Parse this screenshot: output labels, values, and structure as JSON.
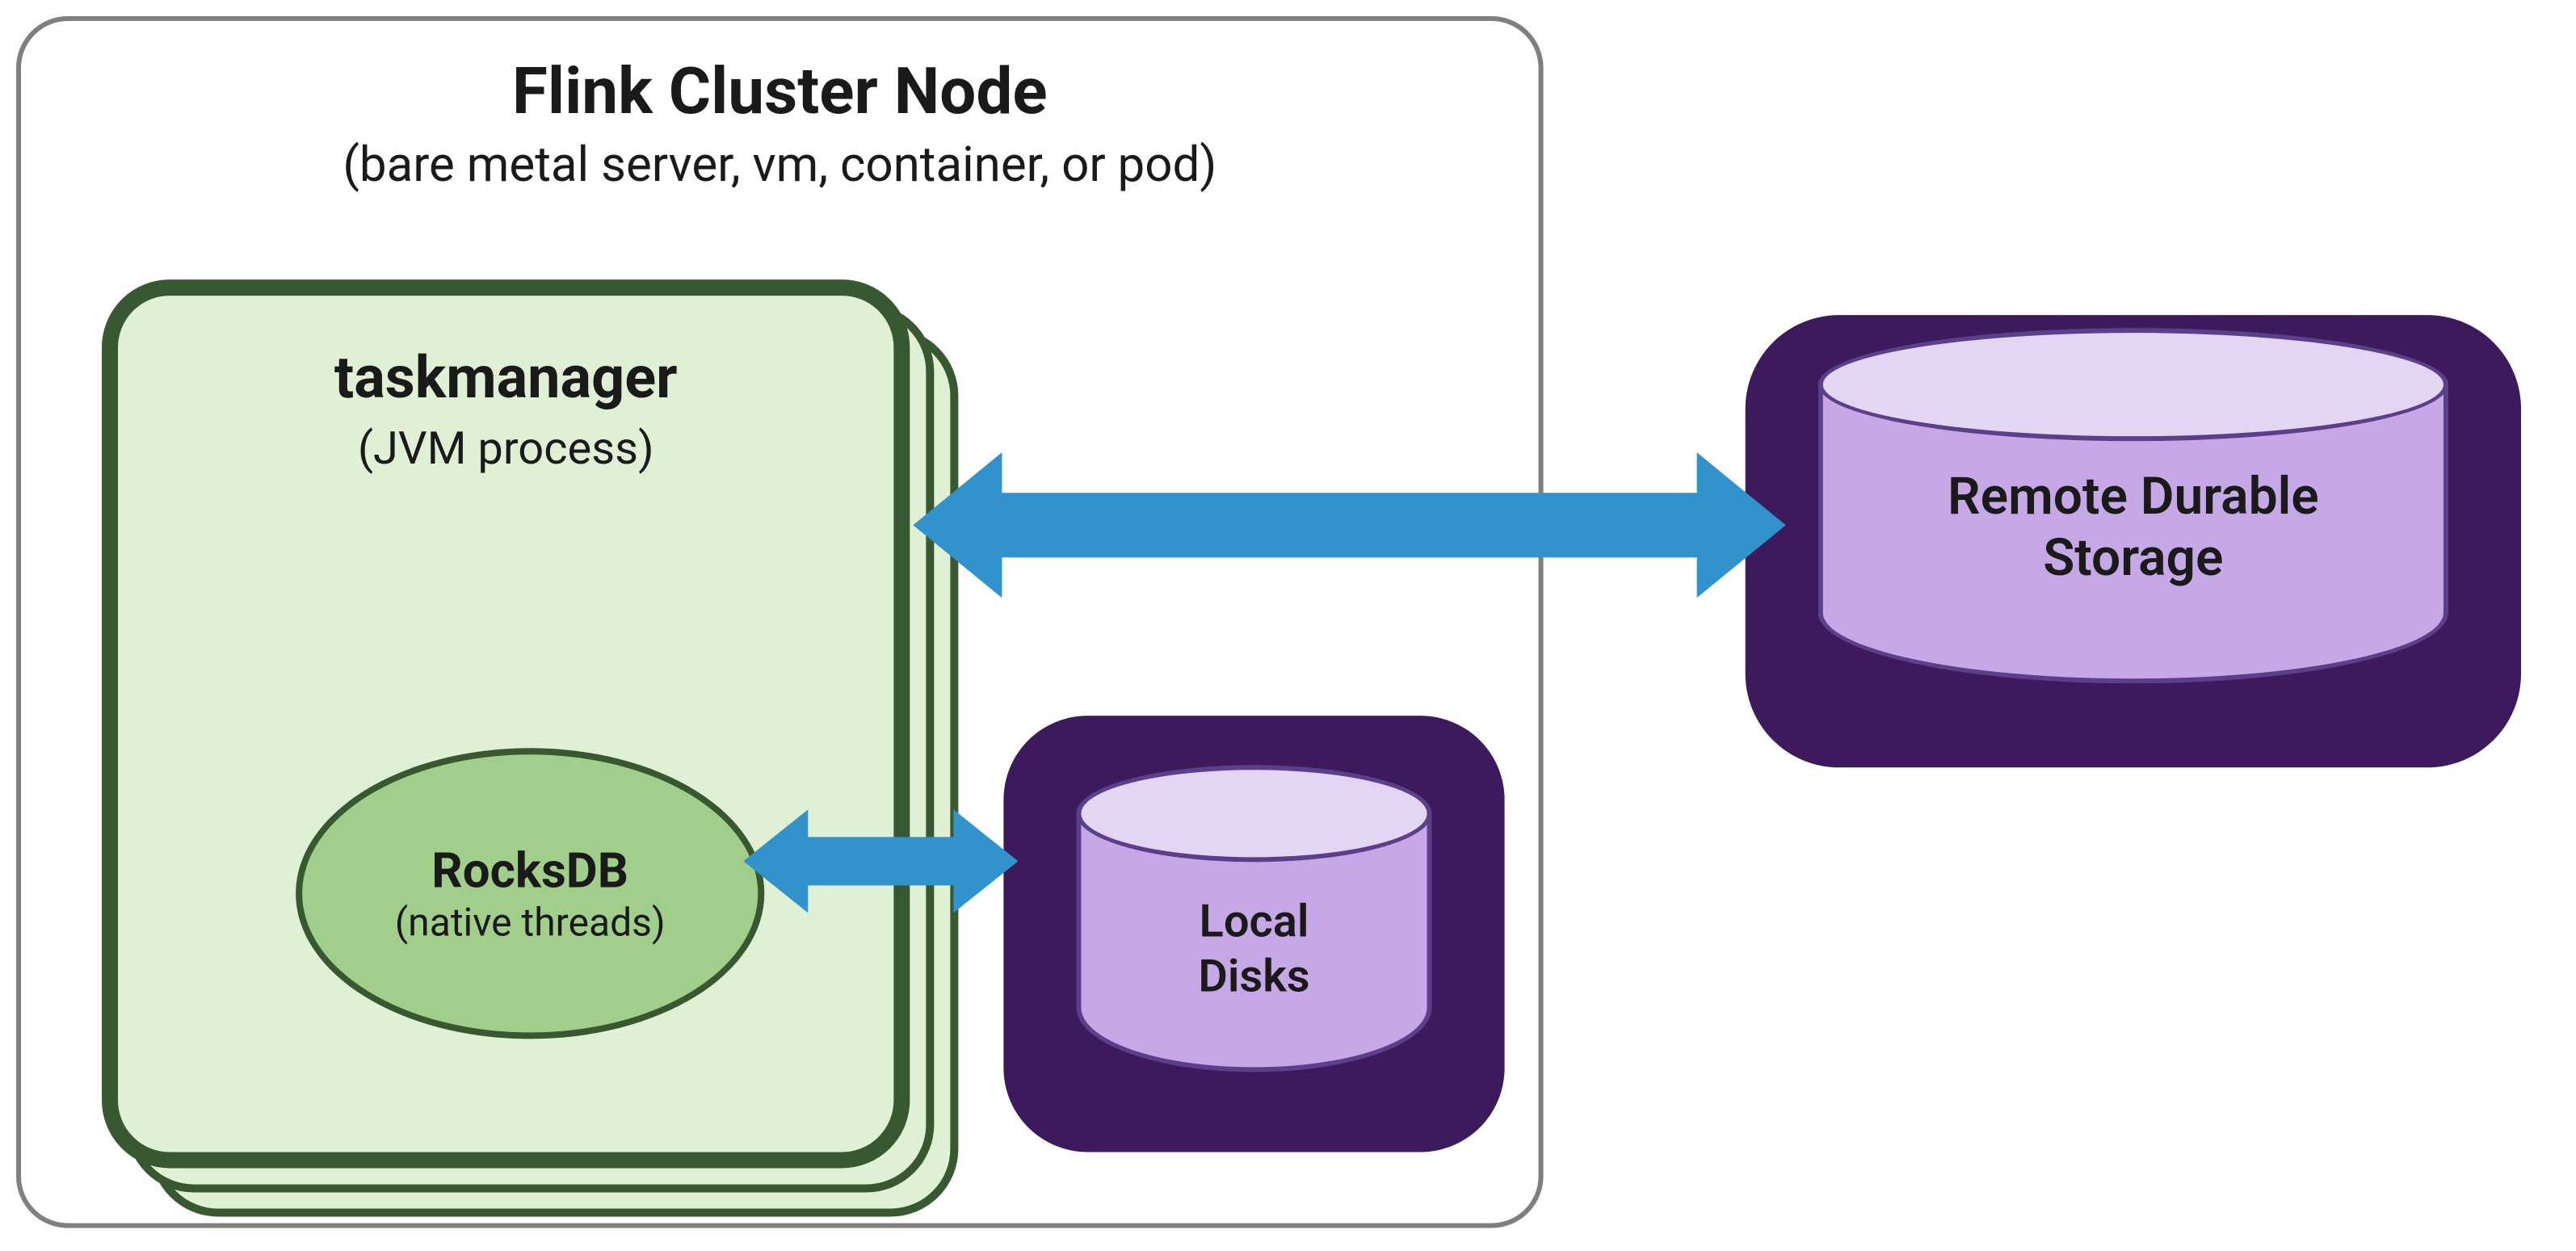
{
  "colors": {
    "green_dark": "#385832",
    "green_light": "#dff0d5",
    "green_mid": "#a1cf8b",
    "purple_dark": "#3d1a5b",
    "purple_light": "#c6a8e6",
    "purple_top": "#e4d5f2",
    "arrow_blue": "#3292cc"
  },
  "cluster": {
    "title": "Flink Cluster Node",
    "subtitle": "(bare metal server, vm, container, or pod)"
  },
  "taskmanager": {
    "title": "taskmanager",
    "subtitle": "(JVM process)"
  },
  "rocksdb": {
    "title": "RocksDB",
    "subtitle": "(native threads)"
  },
  "local_disks": {
    "line1": "Local",
    "line2": "Disks"
  },
  "remote_storage": {
    "line1": "Remote Durable",
    "line2": "Storage"
  }
}
